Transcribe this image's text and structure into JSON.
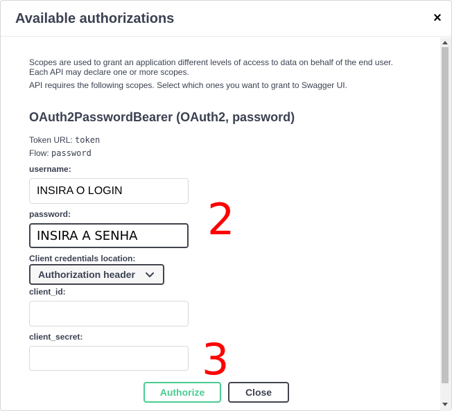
{
  "modal": {
    "title": "Available authorizations",
    "close_glyph": "×"
  },
  "description": {
    "line1": "Scopes are used to grant an application different levels of access to data on behalf of the end user.",
    "line2": "Each API may declare one or more scopes.",
    "line3": "API requires the following scopes. Select which ones you want to grant to Swagger UI."
  },
  "scheme": {
    "title": "OAuth2PasswordBearer (OAuth2, password)",
    "token_url_label": "Token URL:",
    "token_url_value": "token",
    "flow_label": "Flow:",
    "flow_value": "password"
  },
  "form": {
    "username_label": "username:",
    "username_value": "INSIRA O LOGIN",
    "password_label": "password:",
    "password_value": "INSIRA A SENHA",
    "client_credentials_label": "Client credentials location:",
    "client_credentials_selected": "Authorization header",
    "client_id_label": "client_id:",
    "client_id_value": "",
    "client_secret_label": "client_secret:",
    "client_secret_value": ""
  },
  "annotations": {
    "marker_2": "2",
    "marker_3": "3",
    "color": "#ff0000"
  },
  "buttons": {
    "authorize_label": "Authorize",
    "close_label": "Close",
    "authorize_color": "#49cc90"
  },
  "icons": {
    "close": "close-icon",
    "select_chevron": "chevron-down-icon",
    "scroll_up": "scroll-up-arrow-icon",
    "scroll_down": "scroll-down-arrow-icon"
  }
}
